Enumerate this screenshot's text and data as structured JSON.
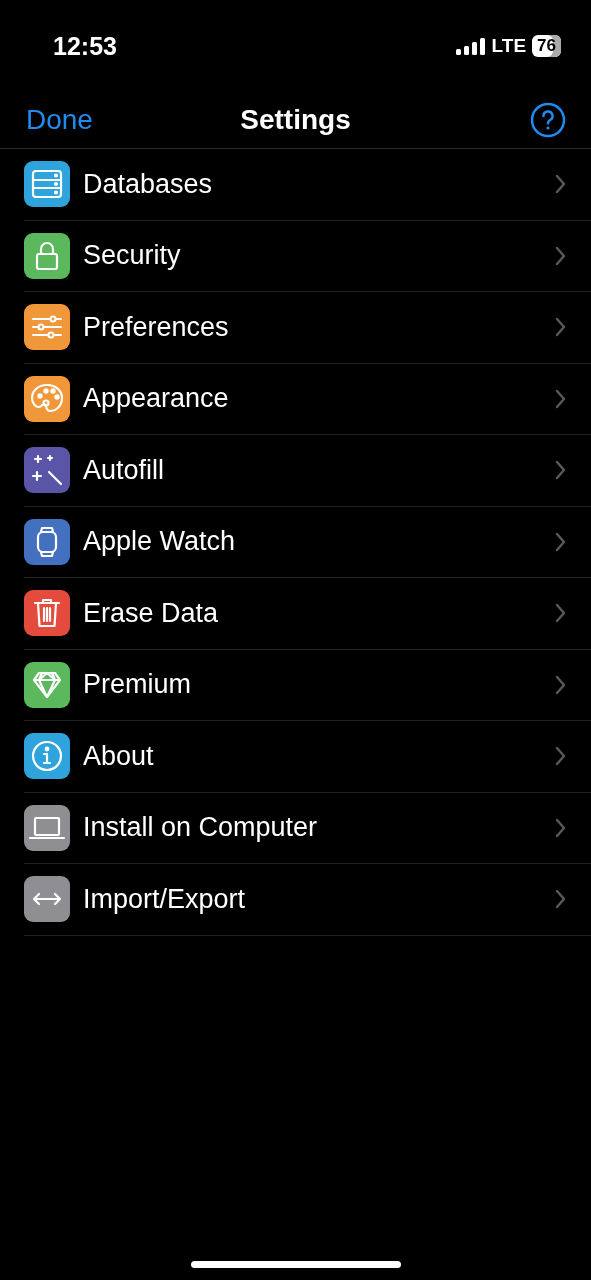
{
  "status_bar": {
    "time": "12:53",
    "network": "LTE",
    "battery": "76"
  },
  "nav": {
    "left_button": "Done",
    "title": "Settings"
  },
  "items": [
    {
      "label": "Databases",
      "kind": "database",
      "color": "#2fa3dc"
    },
    {
      "label": "Security",
      "kind": "lock",
      "color": "#5cb85c"
    },
    {
      "label": "Preferences",
      "kind": "sliders",
      "color": "#f0973a"
    },
    {
      "label": "Appearance",
      "kind": "palette",
      "color": "#f0973a"
    },
    {
      "label": "Autofill",
      "kind": "wand",
      "color": "#5a55a6"
    },
    {
      "label": "Apple Watch",
      "kind": "watch",
      "color": "#4470c0"
    },
    {
      "label": "Erase Data",
      "kind": "trash",
      "color": "#e54b3c"
    },
    {
      "label": "Premium",
      "kind": "diamond",
      "color": "#5cb85c"
    },
    {
      "label": "About",
      "kind": "info",
      "color": "#2fa3dc"
    },
    {
      "label": "Install on Computer",
      "kind": "laptop",
      "color": "#8e8e93"
    },
    {
      "label": "Import/Export",
      "kind": "arrows",
      "color": "#8e8e93"
    }
  ]
}
